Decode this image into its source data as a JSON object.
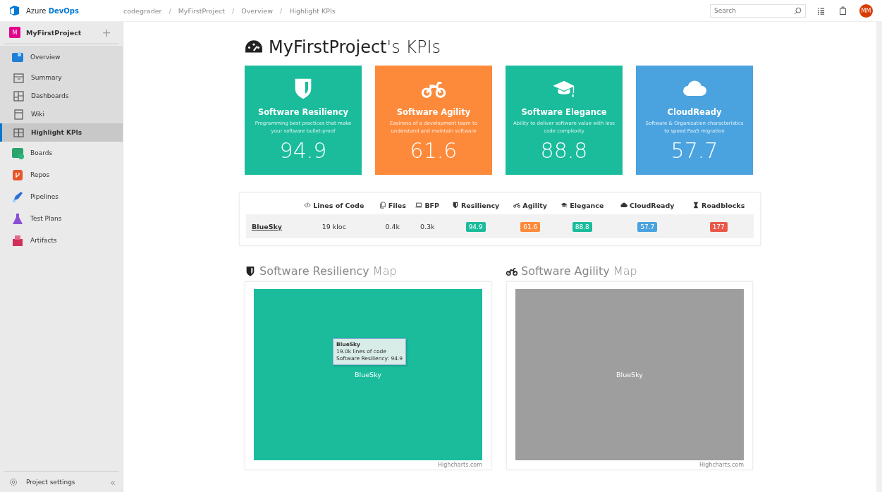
{
  "topbar": {
    "brand_plain": "Azure",
    "brand_bold": "DevOps",
    "breadcrumbs": [
      "codegrader",
      "MyFirstProject",
      "Overview",
      "Highlight KPIs"
    ],
    "separator": "/",
    "search": {
      "placeholder": "Search"
    },
    "avatar": "MM"
  },
  "sidebar": {
    "project": {
      "badge": "M",
      "name": "MyFirstProject",
      "add": "+"
    },
    "items": [
      {
        "label": "Overview",
        "kind": "hub",
        "selected": false,
        "expanded": true
      },
      {
        "label": "Summary",
        "kind": "sub",
        "selected": false
      },
      {
        "label": "Dashboards",
        "kind": "sub",
        "selected": false
      },
      {
        "label": "Wiki",
        "kind": "sub",
        "selected": false
      },
      {
        "label": "Highlight KPIs",
        "kind": "sub",
        "selected": true
      },
      {
        "label": "Boards",
        "kind": "hub",
        "selected": false,
        "expanded": false
      },
      {
        "label": "Repos",
        "kind": "hub",
        "selected": false,
        "expanded": false
      },
      {
        "label": "Pipelines",
        "kind": "hub",
        "selected": false,
        "expanded": false
      },
      {
        "label": "Test Plans",
        "kind": "hub",
        "selected": false,
        "expanded": false
      },
      {
        "label": "Artifacts",
        "kind": "hub",
        "selected": false,
        "expanded": false
      }
    ],
    "footer": {
      "label": "Project settings",
      "collapse": "«"
    }
  },
  "page": {
    "title": "**MyFirstProject**'s KPIs",
    "kpis": [
      {
        "title": "Software Resiliency",
        "description": "Programming best practices that make your software bullet-proof",
        "value": "94.9",
        "color": "#1abc9c"
      },
      {
        "title": "Software Agility",
        "description": "Easiness of a development team to understand and maintain software",
        "value": "61.6",
        "color": "#fd8a3b"
      },
      {
        "title": "Software Elegance",
        "description": "Ability to deliver software value with less code complexity",
        "value": "88.8",
        "color": "#1abc9c"
      },
      {
        "title": "CloudReady",
        "description": "Software & Organization characteristics to speed PaaS migration",
        "value": "57.7",
        "color": "#4aa3df"
      }
    ],
    "table": {
      "columns": [
        "Lines of Code",
        "Files",
        "BFP",
        "Resiliency",
        "Agility",
        "Elegance",
        "CloudReady",
        "Roadblocks"
      ],
      "rows": [
        {
          "name": "BlueSky",
          "cells": [
            {
              "kind": "text",
              "text": "19 kloc"
            },
            {
              "kind": "text",
              "text": "0.4k"
            },
            {
              "kind": "text",
              "text": "0.3k"
            },
            {
              "kind": "badge",
              "text": "94.9",
              "color": "#1abc9c"
            },
            {
              "kind": "badge",
              "text": "61.6",
              "color": "#fd8a3b"
            },
            {
              "kind": "badge",
              "text": "88.8",
              "color": "#1abc9c"
            },
            {
              "kind": "badge",
              "text": "57.7",
              "color": "#4aa3df"
            },
            {
              "kind": "badge",
              "text": "177",
              "color": "#e9594a"
            }
          ]
        }
      ]
    },
    "maps": [
      {
        "title": "**Software Resiliency** Map",
        "tile": {
          "label": "BlueSky",
          "color": "#1abc9c"
        },
        "tooltip": {
          "title": "BlueSky",
          "lines": [
            "19.0k lines of code",
            "Software Resiliency: 94.9"
          ]
        },
        "credit": "Highcharts.com"
      },
      {
        "title": "**Software Agility** Map",
        "tile": {
          "label": "BlueSky",
          "color": "#9e9e9e"
        },
        "credit": "Highcharts.com"
      }
    ]
  }
}
